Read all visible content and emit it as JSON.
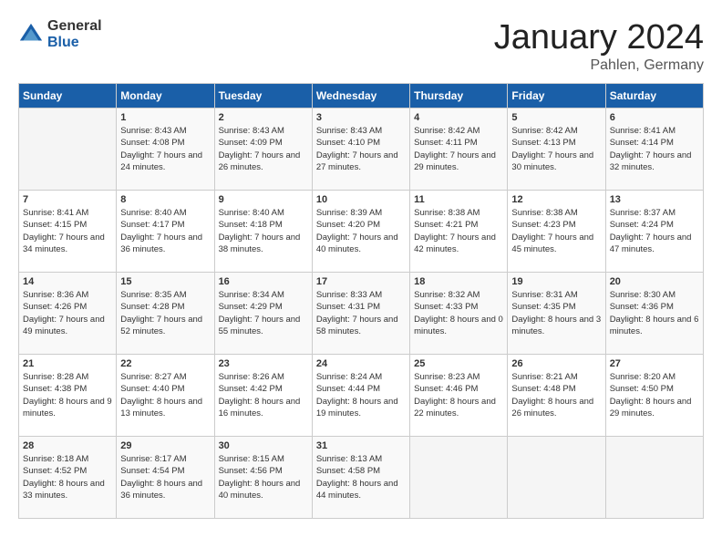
{
  "header": {
    "logo_general": "General",
    "logo_blue": "Blue",
    "month_title": "January 2024",
    "location": "Pahlen, Germany"
  },
  "weekdays": [
    "Sunday",
    "Monday",
    "Tuesday",
    "Wednesday",
    "Thursday",
    "Friday",
    "Saturday"
  ],
  "weeks": [
    [
      {
        "day": "",
        "sunrise": "",
        "sunset": "",
        "daylight": ""
      },
      {
        "day": "1",
        "sunrise": "Sunrise: 8:43 AM",
        "sunset": "Sunset: 4:08 PM",
        "daylight": "Daylight: 7 hours and 24 minutes."
      },
      {
        "day": "2",
        "sunrise": "Sunrise: 8:43 AM",
        "sunset": "Sunset: 4:09 PM",
        "daylight": "Daylight: 7 hours and 26 minutes."
      },
      {
        "day": "3",
        "sunrise": "Sunrise: 8:43 AM",
        "sunset": "Sunset: 4:10 PM",
        "daylight": "Daylight: 7 hours and 27 minutes."
      },
      {
        "day": "4",
        "sunrise": "Sunrise: 8:42 AM",
        "sunset": "Sunset: 4:11 PM",
        "daylight": "Daylight: 7 hours and 29 minutes."
      },
      {
        "day": "5",
        "sunrise": "Sunrise: 8:42 AM",
        "sunset": "Sunset: 4:13 PM",
        "daylight": "Daylight: 7 hours and 30 minutes."
      },
      {
        "day": "6",
        "sunrise": "Sunrise: 8:41 AM",
        "sunset": "Sunset: 4:14 PM",
        "daylight": "Daylight: 7 hours and 32 minutes."
      }
    ],
    [
      {
        "day": "7",
        "sunrise": "Sunrise: 8:41 AM",
        "sunset": "Sunset: 4:15 PM",
        "daylight": "Daylight: 7 hours and 34 minutes."
      },
      {
        "day": "8",
        "sunrise": "Sunrise: 8:40 AM",
        "sunset": "Sunset: 4:17 PM",
        "daylight": "Daylight: 7 hours and 36 minutes."
      },
      {
        "day": "9",
        "sunrise": "Sunrise: 8:40 AM",
        "sunset": "Sunset: 4:18 PM",
        "daylight": "Daylight: 7 hours and 38 minutes."
      },
      {
        "day": "10",
        "sunrise": "Sunrise: 8:39 AM",
        "sunset": "Sunset: 4:20 PM",
        "daylight": "Daylight: 7 hours and 40 minutes."
      },
      {
        "day": "11",
        "sunrise": "Sunrise: 8:38 AM",
        "sunset": "Sunset: 4:21 PM",
        "daylight": "Daylight: 7 hours and 42 minutes."
      },
      {
        "day": "12",
        "sunrise": "Sunrise: 8:38 AM",
        "sunset": "Sunset: 4:23 PM",
        "daylight": "Daylight: 7 hours and 45 minutes."
      },
      {
        "day": "13",
        "sunrise": "Sunrise: 8:37 AM",
        "sunset": "Sunset: 4:24 PM",
        "daylight": "Daylight: 7 hours and 47 minutes."
      }
    ],
    [
      {
        "day": "14",
        "sunrise": "Sunrise: 8:36 AM",
        "sunset": "Sunset: 4:26 PM",
        "daylight": "Daylight: 7 hours and 49 minutes."
      },
      {
        "day": "15",
        "sunrise": "Sunrise: 8:35 AM",
        "sunset": "Sunset: 4:28 PM",
        "daylight": "Daylight: 7 hours and 52 minutes."
      },
      {
        "day": "16",
        "sunrise": "Sunrise: 8:34 AM",
        "sunset": "Sunset: 4:29 PM",
        "daylight": "Daylight: 7 hours and 55 minutes."
      },
      {
        "day": "17",
        "sunrise": "Sunrise: 8:33 AM",
        "sunset": "Sunset: 4:31 PM",
        "daylight": "Daylight: 7 hours and 58 minutes."
      },
      {
        "day": "18",
        "sunrise": "Sunrise: 8:32 AM",
        "sunset": "Sunset: 4:33 PM",
        "daylight": "Daylight: 8 hours and 0 minutes."
      },
      {
        "day": "19",
        "sunrise": "Sunrise: 8:31 AM",
        "sunset": "Sunset: 4:35 PM",
        "daylight": "Daylight: 8 hours and 3 minutes."
      },
      {
        "day": "20",
        "sunrise": "Sunrise: 8:30 AM",
        "sunset": "Sunset: 4:36 PM",
        "daylight": "Daylight: 8 hours and 6 minutes."
      }
    ],
    [
      {
        "day": "21",
        "sunrise": "Sunrise: 8:28 AM",
        "sunset": "Sunset: 4:38 PM",
        "daylight": "Daylight: 8 hours and 9 minutes."
      },
      {
        "day": "22",
        "sunrise": "Sunrise: 8:27 AM",
        "sunset": "Sunset: 4:40 PM",
        "daylight": "Daylight: 8 hours and 13 minutes."
      },
      {
        "day": "23",
        "sunrise": "Sunrise: 8:26 AM",
        "sunset": "Sunset: 4:42 PM",
        "daylight": "Daylight: 8 hours and 16 minutes."
      },
      {
        "day": "24",
        "sunrise": "Sunrise: 8:24 AM",
        "sunset": "Sunset: 4:44 PM",
        "daylight": "Daylight: 8 hours and 19 minutes."
      },
      {
        "day": "25",
        "sunrise": "Sunrise: 8:23 AM",
        "sunset": "Sunset: 4:46 PM",
        "daylight": "Daylight: 8 hours and 22 minutes."
      },
      {
        "day": "26",
        "sunrise": "Sunrise: 8:21 AM",
        "sunset": "Sunset: 4:48 PM",
        "daylight": "Daylight: 8 hours and 26 minutes."
      },
      {
        "day": "27",
        "sunrise": "Sunrise: 8:20 AM",
        "sunset": "Sunset: 4:50 PM",
        "daylight": "Daylight: 8 hours and 29 minutes."
      }
    ],
    [
      {
        "day": "28",
        "sunrise": "Sunrise: 8:18 AM",
        "sunset": "Sunset: 4:52 PM",
        "daylight": "Daylight: 8 hours and 33 minutes."
      },
      {
        "day": "29",
        "sunrise": "Sunrise: 8:17 AM",
        "sunset": "Sunset: 4:54 PM",
        "daylight": "Daylight: 8 hours and 36 minutes."
      },
      {
        "day": "30",
        "sunrise": "Sunrise: 8:15 AM",
        "sunset": "Sunset: 4:56 PM",
        "daylight": "Daylight: 8 hours and 40 minutes."
      },
      {
        "day": "31",
        "sunrise": "Sunrise: 8:13 AM",
        "sunset": "Sunset: 4:58 PM",
        "daylight": "Daylight: 8 hours and 44 minutes."
      },
      {
        "day": "",
        "sunrise": "",
        "sunset": "",
        "daylight": ""
      },
      {
        "day": "",
        "sunrise": "",
        "sunset": "",
        "daylight": ""
      },
      {
        "day": "",
        "sunrise": "",
        "sunset": "",
        "daylight": ""
      }
    ]
  ]
}
